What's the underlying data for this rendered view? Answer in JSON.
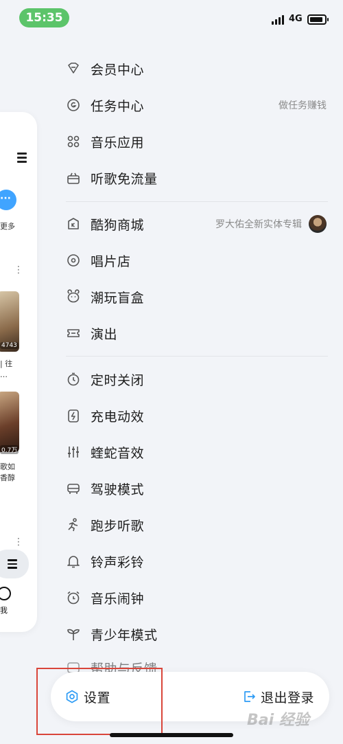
{
  "status_bar": {
    "time": "15:35",
    "network": "4G"
  },
  "background_page": {
    "more_label": "更多",
    "item1_count": "4743",
    "item1_text_line1": "| 往",
    "item1_text_line2": "…",
    "item2_count": "0.7万",
    "item2_text_line1": "歌如",
    "item2_text_line2": "香醇",
    "me_label": "我"
  },
  "menu": {
    "group1": [
      {
        "label": "会员中心",
        "icon": "diamond-icon"
      },
      {
        "label": "任务中心",
        "icon": "coin-icon",
        "extra": "做任务赚钱"
      },
      {
        "label": "音乐应用",
        "icon": "apps-icon"
      },
      {
        "label": "听歌免流量",
        "icon": "gift-icon"
      }
    ],
    "group2": [
      {
        "label": "酷狗商城",
        "icon": "shop-icon",
        "extra": "罗大佑全新实体专辑"
      },
      {
        "label": "唱片店",
        "icon": "disc-icon"
      },
      {
        "label": "潮玩盲盒",
        "icon": "bear-icon"
      },
      {
        "label": "演出",
        "icon": "ticket-icon"
      }
    ],
    "group3": [
      {
        "label": "定时关闭",
        "icon": "timer-icon"
      },
      {
        "label": "充电动效",
        "icon": "charge-icon"
      },
      {
        "label": "蝰蛇音效",
        "icon": "equalizer-icon"
      },
      {
        "label": "驾驶模式",
        "icon": "car-icon"
      },
      {
        "label": "跑步听歌",
        "icon": "running-icon"
      },
      {
        "label": "铃声彩铃",
        "icon": "bell-icon"
      },
      {
        "label": "音乐闹钟",
        "icon": "alarm-icon"
      },
      {
        "label": "青少年模式",
        "icon": "sprout-icon"
      },
      {
        "label": "帮助与反馈",
        "icon": "help-icon"
      }
    ]
  },
  "bottom_bar": {
    "settings_label": "设置",
    "logout_label": "退出登录"
  },
  "watermark": "Bai 经验",
  "colors": {
    "time_pill": "#5cc46a",
    "accent_blue": "#40a4ff",
    "highlight_box": "#d9453a"
  }
}
